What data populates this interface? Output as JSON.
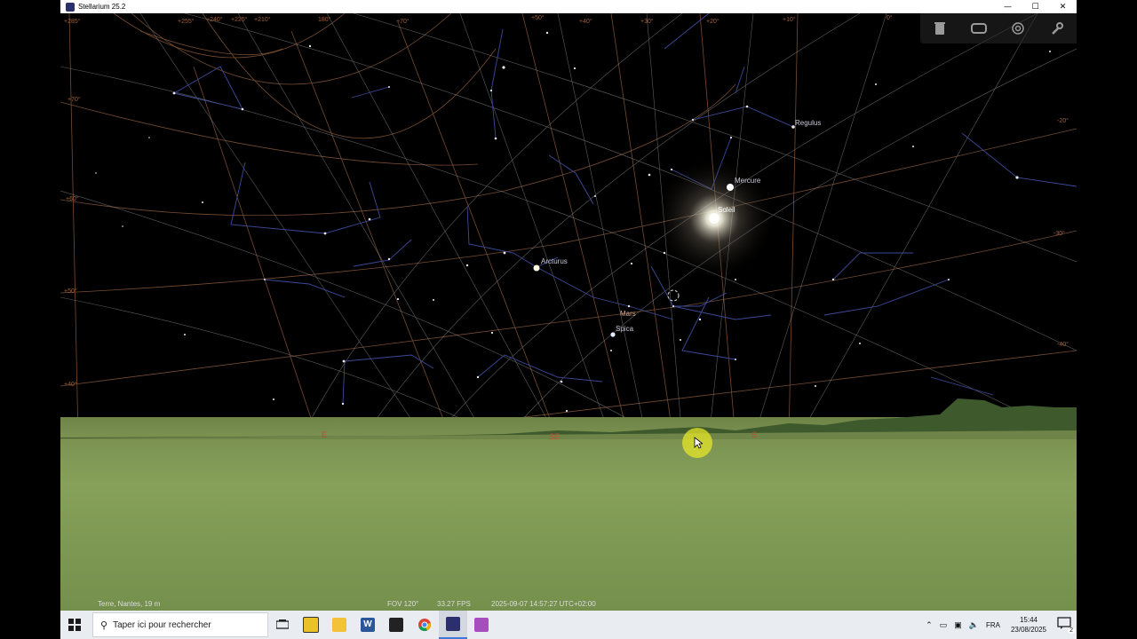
{
  "window": {
    "title": "Stellarium 25.2"
  },
  "controls": {
    "minimize": "—",
    "maximize": "☐",
    "close": "✕"
  },
  "toolbar": {
    "icons": [
      "trash-icon",
      "screen-icon",
      "target-icon",
      "wrench-icon"
    ]
  },
  "sky": {
    "labels": {
      "regulus": "Regulus",
      "mercure": "Mercure",
      "soleil": "Soleil",
      "arcturus": "Arcturus",
      "mars": "Mars",
      "spica": "Spica"
    },
    "grid_labels": {
      "left_70": "+70°",
      "left_60": "+60°",
      "left_50": "+50°",
      "left_40": "+40°",
      "right_20": "-20°",
      "right_30": "-30°",
      "right_40": "-40°",
      "top_0": "0°",
      "top_10": "+10°",
      "top_20": "+20°",
      "top_30": "+30°",
      "top_40": "+40°",
      "top_50": "+50°",
      "top_70": "+70°",
      "top_180": "180°",
      "top_210": "+210°",
      "top_225": "+225°",
      "top_240": "+240°",
      "top_255": "+255°",
      "top_285": "+285°"
    },
    "cardinals": {
      "est": "E",
      "se": "SE",
      "s": "S"
    }
  },
  "status": {
    "location": "Terre, Nantes, 19 m",
    "fov": "FOV 120°",
    "fps": "33.27 FPS",
    "datetime": "2025-09-07 14:57:27 UTC+02:00"
  },
  "taskbar": {
    "search_placeholder": "Taper ici pour rechercher",
    "language": "FRA",
    "time": "15:44",
    "date": "23/08/2025",
    "notifications": "2"
  }
}
